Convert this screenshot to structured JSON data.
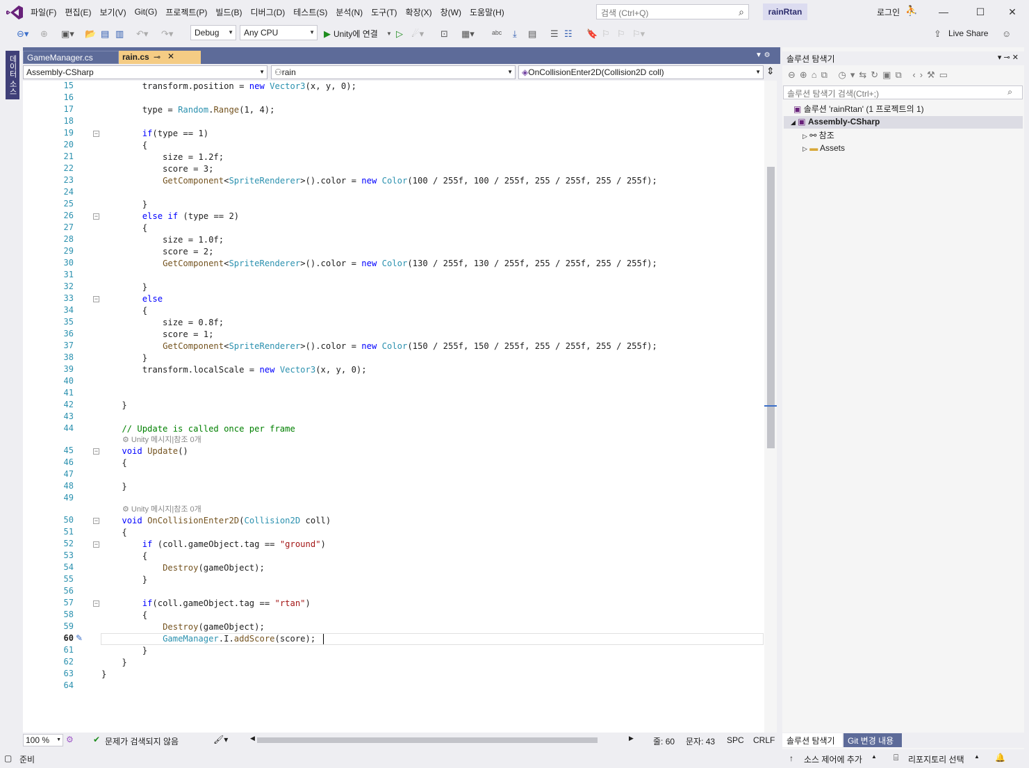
{
  "menu": [
    "파일(F)",
    "편집(E)",
    "보기(V)",
    "Git(G)",
    "프로젝트(P)",
    "빌드(B)",
    "디버그(D)",
    "테스트(S)",
    "분석(N)",
    "도구(T)",
    "확장(X)",
    "창(W)",
    "도움말(H)"
  ],
  "search": {
    "placeholder": "검색 (Ctrl+Q)"
  },
  "project_name": "rainRtan",
  "login": "로그인",
  "toolbar": {
    "config": "Debug",
    "platform": "Any CPU",
    "run_label": "Unity에 연결",
    "live_share": "Live Share"
  },
  "left_strip": {
    "label": "데이터 소스"
  },
  "tabs": [
    {
      "label": "GameManager.cs"
    },
    {
      "label": "rain.cs"
    }
  ],
  "nav": {
    "project": "Assembly-CSharp",
    "class": "rain",
    "member": "OnCollisionEnter2D(Collision2D coll)"
  },
  "editor": {
    "current_line": 60,
    "lines": [
      {
        "n": 15,
        "t": "        transform.position = new Vector3(x, y, 0);"
      },
      {
        "n": 16,
        "t": ""
      },
      {
        "n": 17,
        "t": "        type = Random.Range(1, 4);"
      },
      {
        "n": 18,
        "t": ""
      },
      {
        "n": 19,
        "t": "        if(type == 1)",
        "fold": true
      },
      {
        "n": 20,
        "t": "        {"
      },
      {
        "n": 21,
        "t": "            size = 1.2f;"
      },
      {
        "n": 22,
        "t": "            score = 3;"
      },
      {
        "n": 23,
        "t": "            GetComponent<SpriteRenderer>().color = new Color(100 / 255f, 100 / 255f, 255 / 255f, 255 / 255f);"
      },
      {
        "n": 24,
        "t": ""
      },
      {
        "n": 25,
        "t": "        }"
      },
      {
        "n": 26,
        "t": "        else if (type == 2)",
        "fold": true
      },
      {
        "n": 27,
        "t": "        {"
      },
      {
        "n": 28,
        "t": "            size = 1.0f;"
      },
      {
        "n": 29,
        "t": "            score = 2;"
      },
      {
        "n": 30,
        "t": "            GetComponent<SpriteRenderer>().color = new Color(130 / 255f, 130 / 255f, 255 / 255f, 255 / 255f);"
      },
      {
        "n": 31,
        "t": ""
      },
      {
        "n": 32,
        "t": "        }"
      },
      {
        "n": 33,
        "t": "        else",
        "fold": true
      },
      {
        "n": 34,
        "t": "        {"
      },
      {
        "n": 35,
        "t": "            size = 0.8f;"
      },
      {
        "n": 36,
        "t": "            score = 1;"
      },
      {
        "n": 37,
        "t": "            GetComponent<SpriteRenderer>().color = new Color(150 / 255f, 150 / 255f, 255 / 255f, 255 / 255f);"
      },
      {
        "n": 38,
        "t": "        }"
      },
      {
        "n": 39,
        "t": "        transform.localScale = new Vector3(x, y, 0);"
      },
      {
        "n": 40,
        "t": ""
      },
      {
        "n": 41,
        "t": ""
      },
      {
        "n": 42,
        "t": "    }"
      },
      {
        "n": 43,
        "t": ""
      },
      {
        "n": 44,
        "t": "    // Update is called once per frame",
        "hint": "Unity 메시지|참조 0개"
      },
      {
        "n": 45,
        "t": "    void Update()",
        "fold": true
      },
      {
        "n": 46,
        "t": "    {"
      },
      {
        "n": 47,
        "t": ""
      },
      {
        "n": 48,
        "t": "    }"
      },
      {
        "n": 49,
        "t": "",
        "hint": "Unity 메시지|참조 0개"
      },
      {
        "n": 50,
        "t": "    void OnCollisionEnter2D(Collision2D coll)",
        "fold": true
      },
      {
        "n": 51,
        "t": "    {"
      },
      {
        "n": 52,
        "t": "        if (coll.gameObject.tag == \"ground\")",
        "fold": true
      },
      {
        "n": 53,
        "t": "        {"
      },
      {
        "n": 54,
        "t": "            Destroy(gameObject);"
      },
      {
        "n": 55,
        "t": "        }"
      },
      {
        "n": 56,
        "t": ""
      },
      {
        "n": 57,
        "t": "        if(coll.gameObject.tag == \"rtan\")",
        "fold": true
      },
      {
        "n": 58,
        "t": "        {"
      },
      {
        "n": 59,
        "t": "            Destroy(gameObject);"
      },
      {
        "n": 60,
        "t": "            GameManager.I.addScore(score);"
      },
      {
        "n": 61,
        "t": "        }"
      },
      {
        "n": 62,
        "t": "    }"
      },
      {
        "n": 63,
        "t": "}"
      },
      {
        "n": 64,
        "t": ""
      }
    ]
  },
  "editor_status": {
    "zoom": "100 %",
    "issues": "문제가 검색되지 않음",
    "line": "줄: 60",
    "col": "문자: 43",
    "spc": "SPC",
    "crlf": "CRLF"
  },
  "solution_explorer": {
    "title": "솔루션 탐색기",
    "search_placeholder": "솔루션 탐색기 검색(Ctrl+;)",
    "solution": "솔루션 'rainRtan' (1 프로젝트의 1)",
    "project": "Assembly-CSharp",
    "references": "참조",
    "assets": "Assets",
    "bottom_tabs": [
      "솔루션 탐색기",
      "Git 변경 내용"
    ]
  },
  "statusbar": {
    "ready": "준비",
    "source_control": "소스 제어에 추가",
    "repo": "리포지토리 선택"
  },
  "colors": {
    "accent": "#5d6b99",
    "active_tab": "#f5cc84",
    "keyword": "#0000ff",
    "type": "#2b91af",
    "string": "#a31515",
    "comment": "#008000"
  }
}
